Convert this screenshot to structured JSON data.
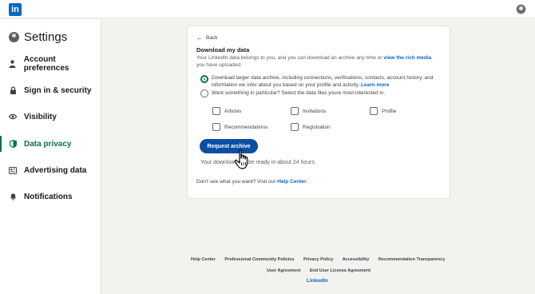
{
  "topbar": {
    "logo_text": "in"
  },
  "sidebar": {
    "title": "Settings",
    "items": [
      {
        "label": "Account preferences",
        "icon": "person-icon"
      },
      {
        "label": "Sign in & security",
        "icon": "lock-icon"
      },
      {
        "label": "Visibility",
        "icon": "eye-icon"
      },
      {
        "label": "Data privacy",
        "icon": "shield-icon",
        "active": true
      },
      {
        "label": "Advertising data",
        "icon": "newspaper-icon"
      },
      {
        "label": "Notifications",
        "icon": "bell-icon"
      }
    ]
  },
  "card": {
    "back_label": "Back",
    "title": "Download my data",
    "desc_text": "Your LinkedIn data belongs to you, and you can download an archive any time or",
    "desc_link": "view the rich media",
    "desc_tail": "you have uploaded.",
    "option1_text": "Download larger data archive, including connections, verifications, contacts, account history, and information we infer about you based on your profile and activity.",
    "option1_link": "Learn more",
    "option2_text": "Want something in particular? Select the data files youre most interested in.",
    "checkboxes": [
      "Articles",
      "Invitations",
      "Profile",
      "Recommendations",
      "Registration"
    ],
    "request_button": "Request archive",
    "ready_text": "Your download will be ready in about 24 hours",
    "help_text": "Don't see what you want? Visit our",
    "help_link": "Help Center",
    "help_tail": "."
  },
  "footer": {
    "row1": [
      "Help Center",
      "Professional Community Policies",
      "Privacy Policy",
      "Accessibility",
      "Recommendation Transparency"
    ],
    "row2": [
      "User Agreement",
      "End User License Agreement"
    ],
    "brand": "LinkedIn"
  },
  "colors": {
    "accent_green": "#057642",
    "brand_blue": "#0a66c2",
    "button_blue": "#0a4fa3",
    "background": "#f4f2ee"
  }
}
